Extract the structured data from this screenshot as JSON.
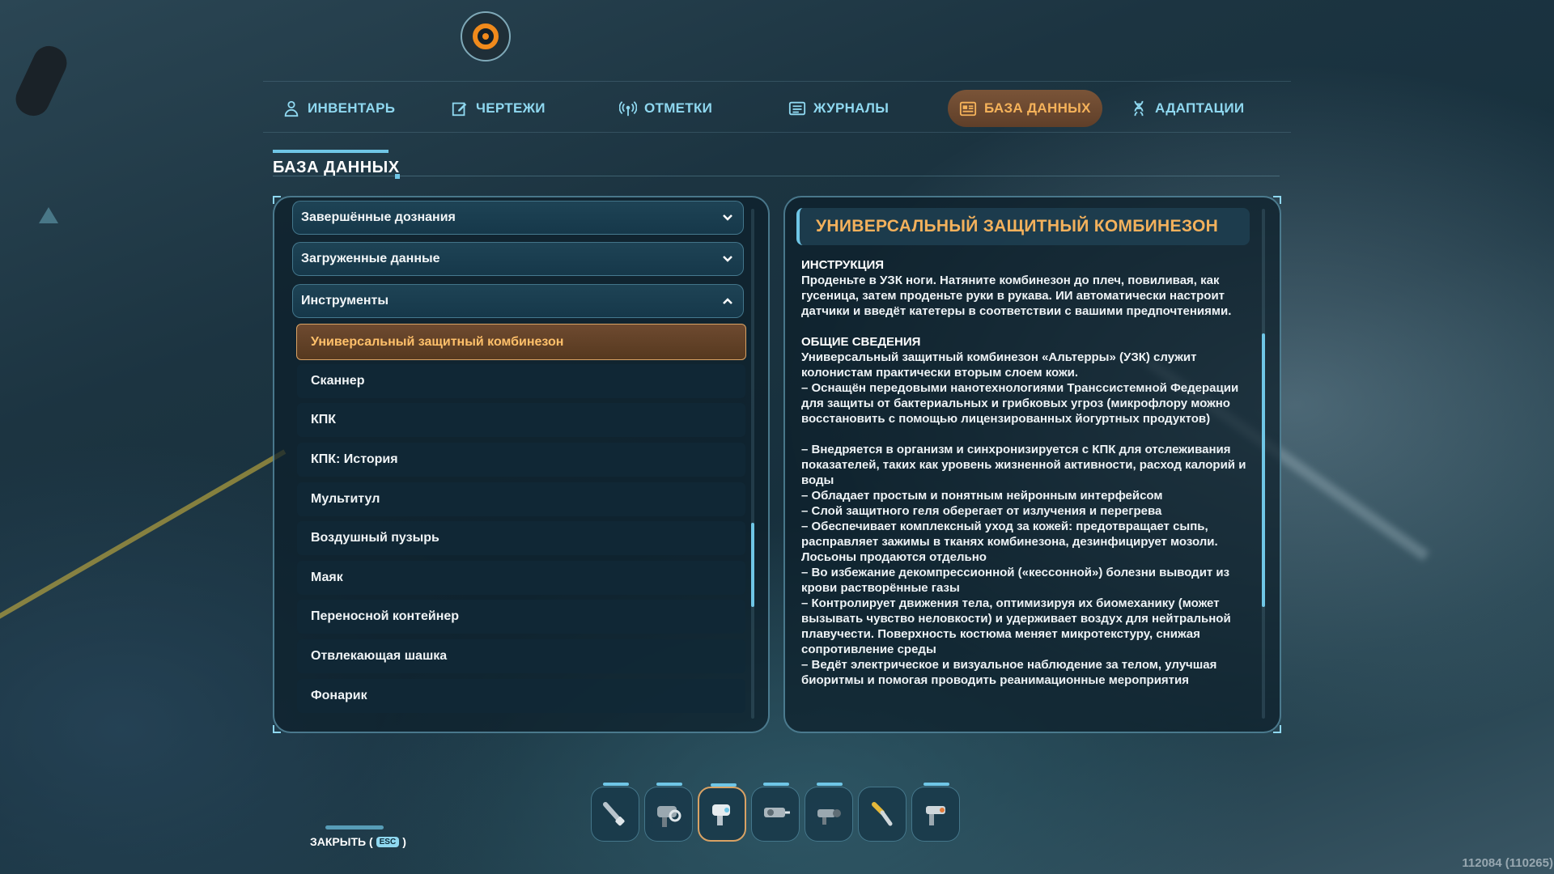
{
  "nav": {
    "tabs": [
      {
        "label": "ИНВЕНТАРЬ",
        "icon": "person-icon",
        "active": false
      },
      {
        "label": "ЧЕРТЕЖИ",
        "icon": "blueprint-pencil-icon",
        "active": false
      },
      {
        "label": "ОТМЕТКИ",
        "icon": "signal-beacon-icon",
        "active": false
      },
      {
        "label": "ЖУРНАЛЫ",
        "icon": "log-list-icon",
        "active": false
      },
      {
        "label": "БАЗА ДАННЫХ",
        "icon": "database-icon",
        "active": true
      },
      {
        "label": "АДАПТАЦИИ",
        "icon": "dna-icon",
        "active": false
      }
    ]
  },
  "section": {
    "title": "БАЗА ДАННЫХ"
  },
  "database": {
    "categories": [
      {
        "label": "Завершённые дознания",
        "expanded": false
      },
      {
        "label": "Загруженные данные",
        "expanded": false
      },
      {
        "label": "Инструменты",
        "expanded": true
      }
    ],
    "entries": [
      "Универсальный защитный комбинезон",
      "Сканнер",
      "КПК",
      "КПК: История",
      "Мультитул",
      "Воздушный пузырь",
      "Маяк",
      "Переносной контейнер",
      "Отвлекающая шашка",
      "Фонарик"
    ],
    "selected_index": 0
  },
  "detail": {
    "title": "УНИВЕРСАЛЬНЫЙ ЗАЩИТНЫЙ КОМБИНЕЗОН",
    "instructions_heading": "ИНСТРУКЦИЯ",
    "instructions_text": "Проденьте в УЗК ноги. Натяните комбинезон до плеч, повиливая, как гусеница, затем проденьте руки в рукава. ИИ автоматически настроит датчики и введёт катетеры в соответствии с вашими предпочтениями.",
    "general_heading": "ОБЩИЕ СВЕДЕНИЯ",
    "general_intro": "Универсальный защитный комбинезон «Альтерры» (УЗК) служит колонистам практически вторым слоем кожи.\n– Оснащён передовыми нанотехнологиями Транссистемной Федерации для защиты от бактериальных и грибковых угроз (микрофлору можно восстановить с помощью лицензированных йогуртных продуктов)",
    "features": "– Внедряется в организм и синхронизируется с КПК для отслеживания показателей, таких как уровень жизненной активности, расход калорий и воды\n– Обладает простым и понятным нейронным интерфейсом\n– Слой защитного геля оберегает от излучения и перегрева\n– Обеспечивает комплексный уход за кожей: предотвращает сыпь, расправляет зажимы в тканях комбинезона, дезинфицирует мозоли. Лосьоны продаются отдельно\n– Во избежание декомпрессионной («кессонной») болезни выводит из крови растворённые газы\n– Контролирует движения тела, оптимизируя их биомеханику (может вызывать чувство неловкости) и удерживает воздух для нейтральной плавучести. Поверхность костюма меняет микротекстуру, снижая сопротивление среды\n– Ведёт электрическое и визуальное наблюдение за телом, улучшая биоритмы и помогая проводить реанимационные мероприятия"
  },
  "hotbar": {
    "slots": [
      {
        "icon": "flashlight-tool-icon",
        "equipped": false,
        "charged": true
      },
      {
        "icon": "scanner-tool-icon",
        "equipped": false,
        "charged": true
      },
      {
        "icon": "multitool-icon",
        "equipped": true,
        "charged": true
      },
      {
        "icon": "drill-gun-icon",
        "equipped": false,
        "charged": true
      },
      {
        "icon": "repair-tool-icon",
        "equipped": false,
        "charged": true
      },
      {
        "icon": "welder-torch-icon",
        "equipped": false,
        "charged": false
      },
      {
        "icon": "survey-gun-icon",
        "equipped": false,
        "charged": true
      }
    ]
  },
  "footer": {
    "close_label": "ЗАКРЫТЬ (",
    "close_key": "ESC",
    "close_suffix": ")",
    "version": "112084 (110265)"
  },
  "colors": {
    "accent": "#6fc6e6",
    "active_tab": "#f5b25a",
    "selected_entry": "#ffc06a",
    "detail_title": "#f3b15c"
  }
}
